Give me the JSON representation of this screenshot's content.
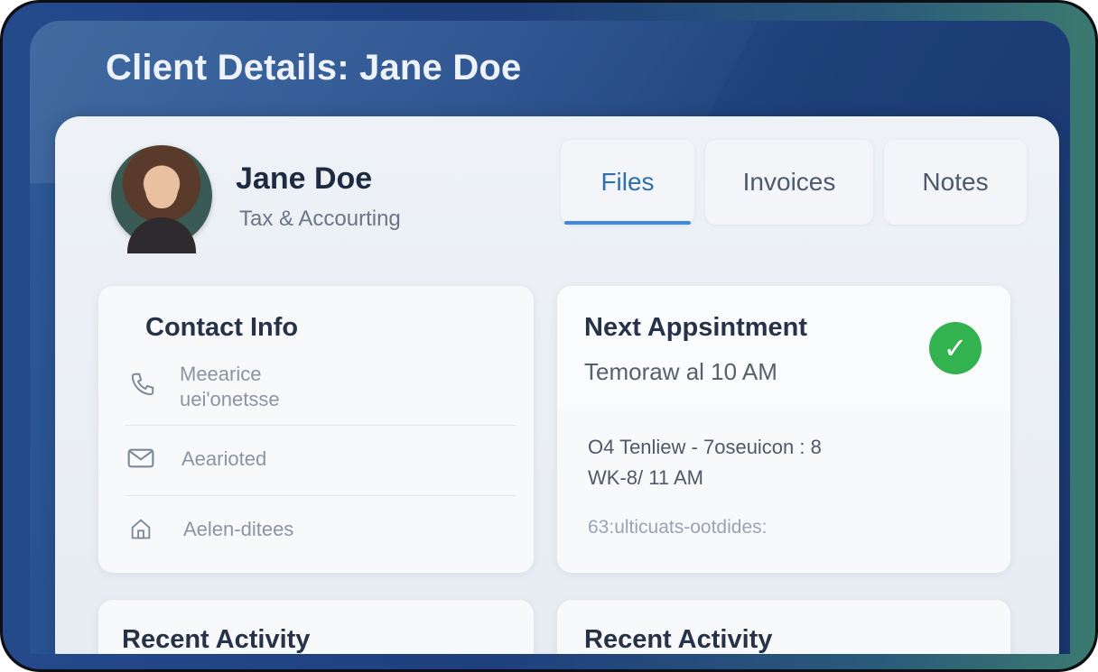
{
  "window": {
    "title": "Client Details: Jane Doe"
  },
  "profile": {
    "name": "Jane Doe",
    "subtitle": "Tax & Accourting"
  },
  "tabs": [
    {
      "label": "Files",
      "active": true
    },
    {
      "label": "Invoices",
      "active": false
    },
    {
      "label": "Notes",
      "active": false
    }
  ],
  "contact": {
    "title": "Contact Info",
    "rows": [
      {
        "icon": "phone-icon",
        "lines": [
          "Meearice",
          "uei'onetsse"
        ]
      },
      {
        "icon": "mail-icon",
        "lines": [
          "Aearioted"
        ]
      },
      {
        "icon": "home-icon",
        "lines": [
          "Aelen-ditees"
        ]
      }
    ]
  },
  "appointment": {
    "title": "Next Appsintment",
    "time": "Temoraw al 10 AM",
    "status_icon": "check-icon",
    "status_color": "#33b34f",
    "details": [
      "O4 Tenliew - 7oseuicon : 8",
      "WK-8/ 11 AM",
      "63:ulticuats-ootdides:"
    ]
  },
  "activity_left": {
    "title": "Recent Activity"
  },
  "activity_right": {
    "title": "Recent Activity"
  },
  "colors": {
    "accent": "#3d8ae0",
    "header_bg": "#264f8d",
    "success": "#33b34f"
  }
}
